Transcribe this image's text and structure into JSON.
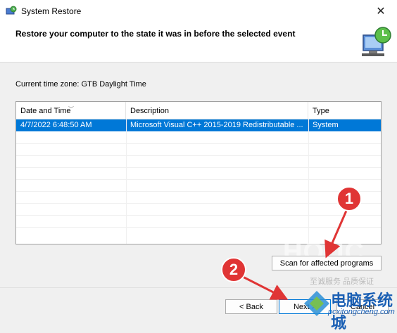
{
  "window": {
    "title": "System Restore",
    "close_glyph": "✕"
  },
  "header": {
    "title": "Restore your computer to the state it was in before the selected event"
  },
  "timezone": "Current time zone: GTB Daylight Time",
  "table": {
    "columns": [
      "Date and Time",
      "Description",
      "Type"
    ],
    "rows": [
      {
        "date": "4/7/2022 6:48:50 AM",
        "description": "Microsoft Visual C++ 2015-2019 Redistributable ...",
        "type": "System",
        "selected": true
      }
    ]
  },
  "buttons": {
    "scan": "Scan for affected programs",
    "back": "< Back",
    "next": "Next >",
    "cancel": "Cancel"
  },
  "callouts": [
    "1",
    "2"
  ],
  "watermark": {
    "text": "HOUC",
    "sub": "至诚服务 品质保证",
    "cn": "电脑系统城",
    "url": "pcxitongcheng.com"
  },
  "colors": {
    "selection": "#0078d7",
    "callout": "#e03535"
  },
  "icons": {
    "app": "system-restore-icon",
    "header": "computer-restore-icon",
    "close": "close-icon"
  }
}
